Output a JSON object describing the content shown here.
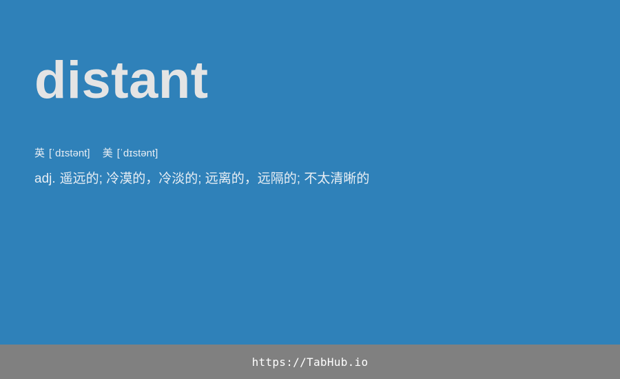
{
  "entry": {
    "word": "distant",
    "phonetics": [
      {
        "region": "英",
        "ipa": "[ˈdɪstənt]"
      },
      {
        "region": "美",
        "ipa": "[ˈdɪstənt]"
      }
    ],
    "definition": {
      "pos": "adj.",
      "meaning": "遥远的; 冷漠的，冷淡的; 远离的，远隔的; 不太清晰的"
    }
  },
  "footer": {
    "link_text": "https://TabHub.io"
  },
  "colors": {
    "background": "#2f81b9",
    "word": "#e4e4e4",
    "footer_bar": "#808080"
  }
}
